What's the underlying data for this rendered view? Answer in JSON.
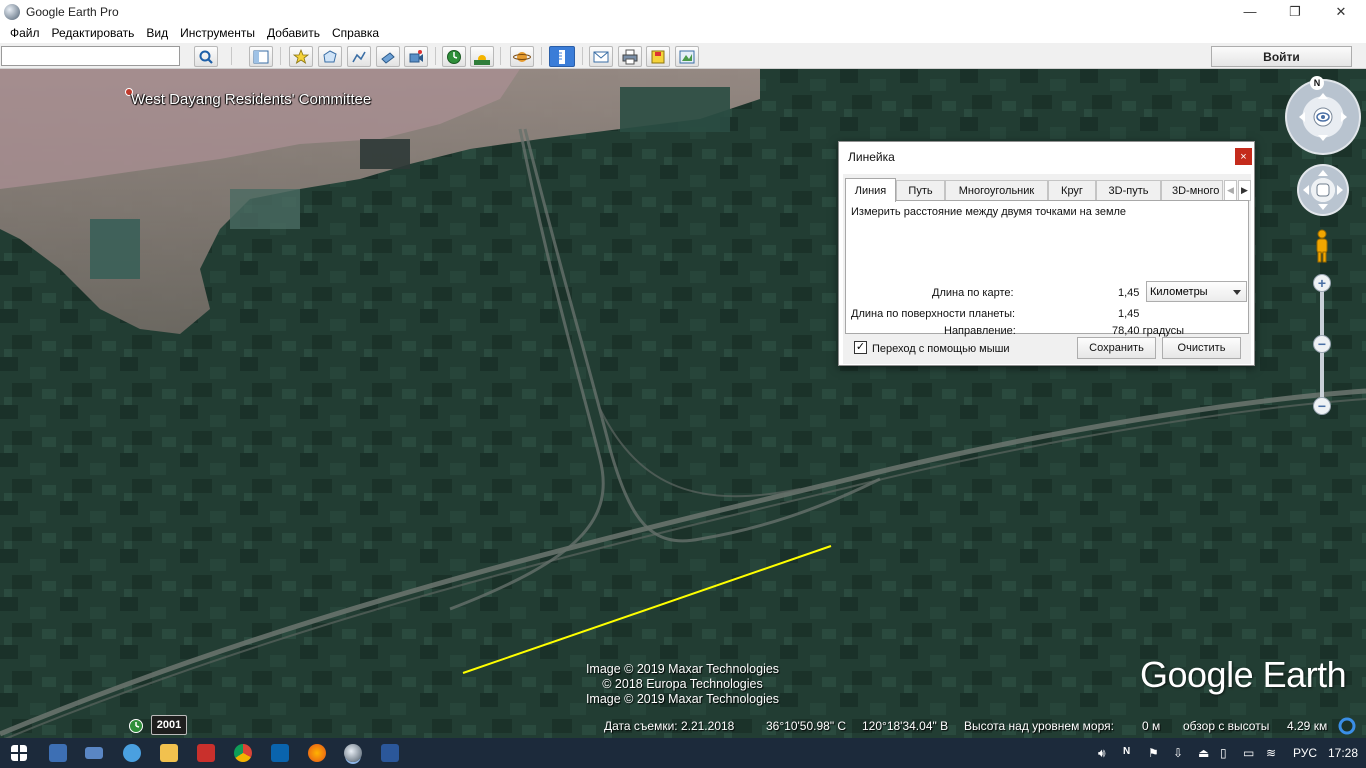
{
  "window": {
    "title": "Google Earth Pro",
    "minimize_glyph": "—",
    "maximize_glyph": "❐",
    "close_glyph": "✕"
  },
  "menu": [
    "Файл",
    "Редактировать",
    "Вид",
    "Инструменты",
    "Добавить",
    "Справка"
  ],
  "toolbar": {
    "search_value": "",
    "login_label": "Войти",
    "icons": [
      "search-icon",
      "sidebar-icon",
      "placemark-icon",
      "polygon-icon",
      "path-icon",
      "overlay-icon",
      "record-tour-icon",
      "historical-imagery-icon",
      "sunlight-icon",
      "planets-icon",
      "ruler-icon",
      "email-icon",
      "print-icon",
      "save-image-icon",
      "view-in-maps-icon"
    ]
  },
  "map": {
    "place_label": "West Dayang Residents' Committee",
    "credits": [
      "Image © 2019 Maxar Technologies",
      "© 2018 Europa Technologies",
      "Image © 2019 Maxar Technologies"
    ],
    "brand": "Google Earth",
    "measure_line_color": "#ffff00"
  },
  "status": {
    "year": "2001",
    "date": "Дата съемки: 2.21.2018",
    "lat": "36°10'50.98\" С",
    "lon": "120°18'34.04\" В",
    "elevation_label": "Высота над уровнем моря:",
    "elevation_value": "0 м",
    "eye_alt_label": "обзор с высоты",
    "eye_alt_value": "4.29 км"
  },
  "nav": {
    "north": "N",
    "zoom_in": "+",
    "zoom_out": "−"
  },
  "ruler": {
    "title": "Линейка",
    "close": "×",
    "tabs": [
      "Линия",
      "Путь",
      "Многоугольник",
      "Круг",
      "3D-путь",
      "3D-много"
    ],
    "active_tab": "Линия",
    "description": "Измерить расстояние между двумя точками на земле",
    "map_length_label": "Длина по карте:",
    "map_length_value": "1,45",
    "units": "Километры",
    "ground_length_label": "Длина по поверхности планеты:",
    "ground_length_value": "1,45",
    "heading_label": "Направление:",
    "heading_value": "78,40 градусы",
    "mouse_nav_label": "Переход с помощью мыши",
    "mouse_nav_checked": true,
    "save_label": "Сохранить",
    "clear_label": "Очистить"
  },
  "taskbar": {
    "apps": [
      "calculator-icon",
      "keyboard-icon",
      "settings-icon",
      "file-explorer-icon",
      "pdf-icon",
      "chrome-icon",
      "outlook-icon",
      "firefox-icon",
      "google-earth-icon",
      "word-icon"
    ],
    "tray": {
      "lang": "РУС",
      "time": "17:28"
    }
  }
}
